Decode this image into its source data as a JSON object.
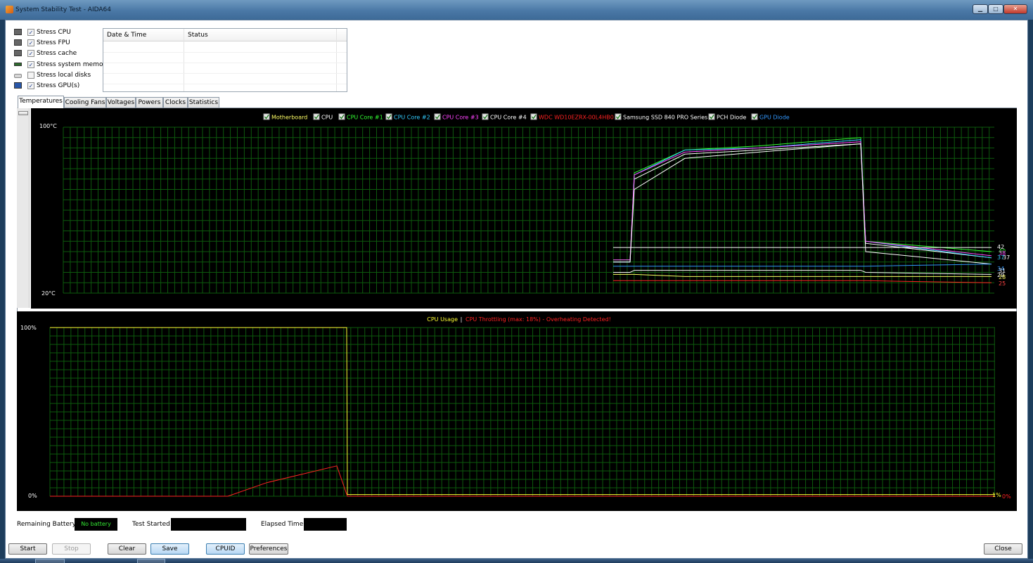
{
  "window": {
    "title": "System Stability Test - AIDA64",
    "minimize_label": "▁",
    "maximize_label": "□",
    "close_label": "✕"
  },
  "stress_options": [
    {
      "label": "Stress CPU",
      "checked": true,
      "icon": "cpu-icon"
    },
    {
      "label": "Stress FPU",
      "checked": true,
      "icon": "fpu-icon"
    },
    {
      "label": "Stress cache",
      "checked": true,
      "icon": "cache-icon"
    },
    {
      "label": "Stress system memory",
      "checked": true,
      "icon": "memory-icon"
    },
    {
      "label": "Stress local disks",
      "checked": false,
      "icon": "disk-icon"
    },
    {
      "label": "Stress GPU(s)",
      "checked": true,
      "icon": "gpu-icon"
    }
  ],
  "log_table": {
    "columns": [
      "Date & Time",
      "Status"
    ],
    "rows": []
  },
  "tabs": [
    "Temperatures",
    "Cooling Fans",
    "Voltages",
    "Powers",
    "Clocks",
    "Statistics"
  ],
  "active_tab": "Temperatures",
  "temperature_chart": {
    "legend": [
      {
        "name": "Motherboard",
        "color": "#ffff66"
      },
      {
        "name": "CPU",
        "color": "#ffffff"
      },
      {
        "name": "CPU Core #1",
        "color": "#33ff33"
      },
      {
        "name": "CPU Core #2",
        "color": "#33ccff"
      },
      {
        "name": "CPU Core #3",
        "color": "#ff44ff"
      },
      {
        "name": "CPU Core #4",
        "color": "#ffffff"
      },
      {
        "name": "WDC WD10EZRX-00L4HB0",
        "color": "#ff2222"
      },
      {
        "name": "Samsung SSD 840 PRO Series",
        "color": "#ffffff"
      },
      {
        "name": "PCH Diode",
        "color": "#ffffff"
      },
      {
        "name": "GPU Diode",
        "color": "#3399ff"
      }
    ],
    "y_max_label": "100°C",
    "y_min_label": "20°C",
    "end_values": [
      {
        "text": "42",
        "color": "#ffffff"
      },
      {
        "text": "40",
        "color": "#33ff33"
      },
      {
        "text": "38",
        "color": "#ff44ff"
      },
      {
        "text": "37",
        "color": "#ffffff"
      },
      {
        "text": "37",
        "color": "#33ccff"
      },
      {
        "text": "34",
        "color": "#3399ff"
      },
      {
        "text": "31",
        "color": "#ffffff"
      },
      {
        "text": "29",
        "color": "#ffffff"
      },
      {
        "text": "28",
        "color": "#ffff66"
      },
      {
        "text": "25",
        "color": "#ff4444"
      }
    ]
  },
  "usage_chart": {
    "title_cpu_usage": "CPU Usage",
    "separator": "|",
    "title_throttling": "CPU Throttling (max: 18%) - Overheating Detected!",
    "y_max_label": "100%",
    "y_min_label": "0%",
    "end_usage": "1%",
    "end_throttling": "0%",
    "usage_color": "#ffff33",
    "throttling_color": "#ff2222"
  },
  "chart_data": [
    {
      "type": "line",
      "title": "",
      "ylabel": "°C",
      "ylim": [
        20,
        100
      ],
      "grid": true,
      "legend_placement": "top-center",
      "series": [
        {
          "name": "Motherboard",
          "values": [
            29,
            29,
            29,
            28,
            28,
            28,
            28,
            28
          ]
        },
        {
          "name": "CPU",
          "values": [
            35,
            35,
            75,
            87,
            89,
            92,
            44,
            37
          ]
        },
        {
          "name": "CPU Core #1",
          "values": [
            36,
            36,
            78,
            89,
            91,
            95,
            45,
            40
          ]
        },
        {
          "name": "CPU Core #2",
          "values": [
            35,
            35,
            77,
            89,
            90,
            94,
            45,
            37
          ]
        },
        {
          "name": "CPU Core #3",
          "values": [
            36,
            36,
            77,
            88,
            90,
            93,
            45,
            38
          ]
        },
        {
          "name": "CPU Core #4",
          "values": [
            35,
            35,
            70,
            85,
            88,
            92,
            40,
            34
          ]
        },
        {
          "name": "WDC WD10EZRX-00L4HB0",
          "values": [
            26,
            26,
            26,
            26,
            26,
            26,
            26,
            25
          ]
        },
        {
          "name": "Samsung SSD 840 PRO Series",
          "values": [
            30,
            30,
            31,
            31,
            31,
            31,
            30,
            29
          ]
        },
        {
          "name": "PCH Diode",
          "values": [
            42,
            42,
            42,
            42,
            42,
            42,
            42,
            42
          ]
        },
        {
          "name": "GPU Diode",
          "values": [
            33,
            33,
            33,
            33,
            33,
            33,
            33,
            34
          ]
        }
      ]
    },
    {
      "type": "line",
      "title": "CPU Usage | CPU Throttling (max: 18%) - Overheating Detected!",
      "ylim": [
        0,
        100
      ],
      "grid": true,
      "series": [
        {
          "name": "CPU Usage",
          "values": [
            100,
            100,
            100,
            100,
            1,
            1,
            1,
            1
          ]
        },
        {
          "name": "CPU Throttling",
          "values": [
            0,
            0,
            8,
            18,
            0,
            0,
            0,
            0
          ]
        }
      ]
    }
  ],
  "status": {
    "battery_label": "Remaining Battery:",
    "battery_value": "No battery",
    "test_started_label": "Test Started:",
    "test_started_value": "",
    "elapsed_label": "Elapsed Time:",
    "elapsed_value": ""
  },
  "buttons": {
    "start": "Start",
    "stop": "Stop",
    "clear": "Clear",
    "save": "Save",
    "cpuid": "CPUID",
    "preferences": "Preferences",
    "close": "Close"
  }
}
